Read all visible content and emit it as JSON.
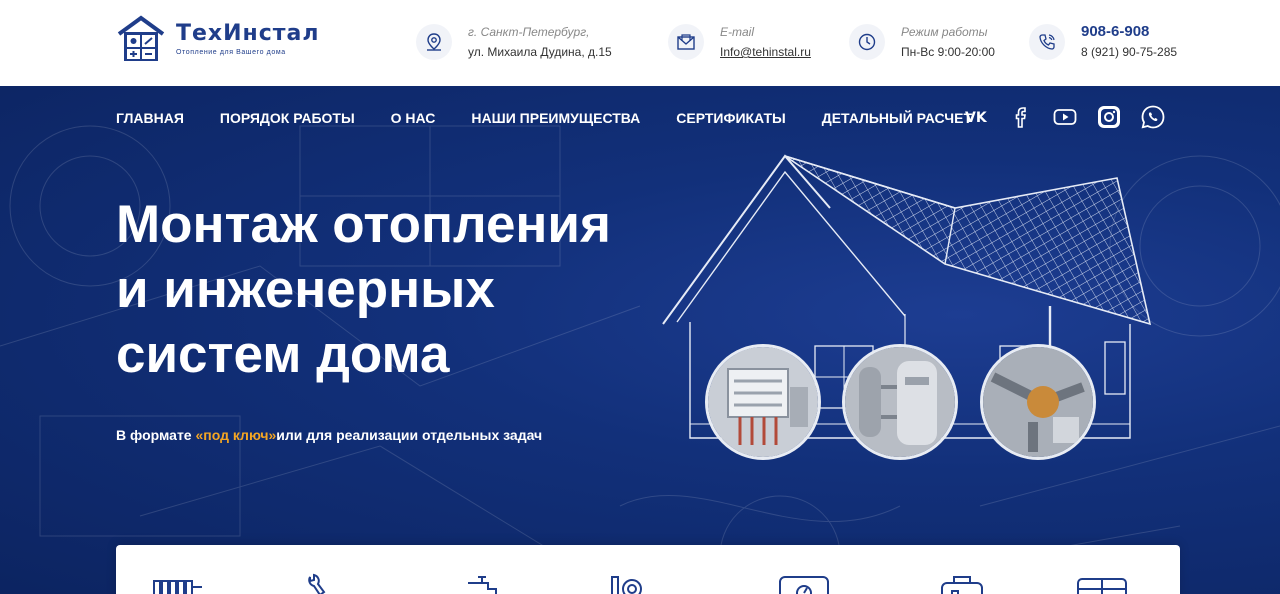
{
  "brand": {
    "name": "ТехИнстал",
    "tagline": "Отопление для Вашего дома"
  },
  "contacts": {
    "address": {
      "caption": "г. Санкт-Петербург,",
      "value": "ул. Михаила Дудина, д.15",
      "icon": "map-pin-icon"
    },
    "email": {
      "caption": "E-mail",
      "value": "Info@tehinstal.ru",
      "icon": "envelope-icon"
    },
    "hours": {
      "caption": "Режим работы",
      "value": "Пн-Вс 9:00-20:00",
      "icon": "clock-icon"
    },
    "phone": {
      "main": "908-6-908",
      "secondary": "8 (921) 90-75-285",
      "icon": "phone-icon"
    }
  },
  "nav": {
    "items": [
      "ГЛАВНАЯ",
      "ПОРЯДОК РАБОТЫ",
      "О НАС",
      "НАШИ ПРЕИМУЩЕСТВА",
      "СЕРТИФИКАТЫ",
      "ДЕТАЛЬНЫЙ РАСЧЕТ"
    ]
  },
  "social": [
    "vk-icon",
    "facebook-icon",
    "youtube-icon",
    "instagram-icon",
    "whatsapp-icon"
  ],
  "hero": {
    "title_lines": [
      "Монтаж отопления",
      "и инженерных",
      "систем дома"
    ],
    "subtitle_before": "В формате ",
    "subtitle_accent": "«под ключ»",
    "subtitle_after": "или для реализации отдельных задач"
  },
  "features": [
    "radiator-icon",
    "wrench-icon",
    "faucet-icon",
    "boiler-icon",
    "meter-icon",
    "pump-icon",
    "tank-icon"
  ],
  "colors": {
    "brand_blue": "#1f3d8a",
    "hero_bg": "#12307a",
    "accent": "#f5a623"
  }
}
